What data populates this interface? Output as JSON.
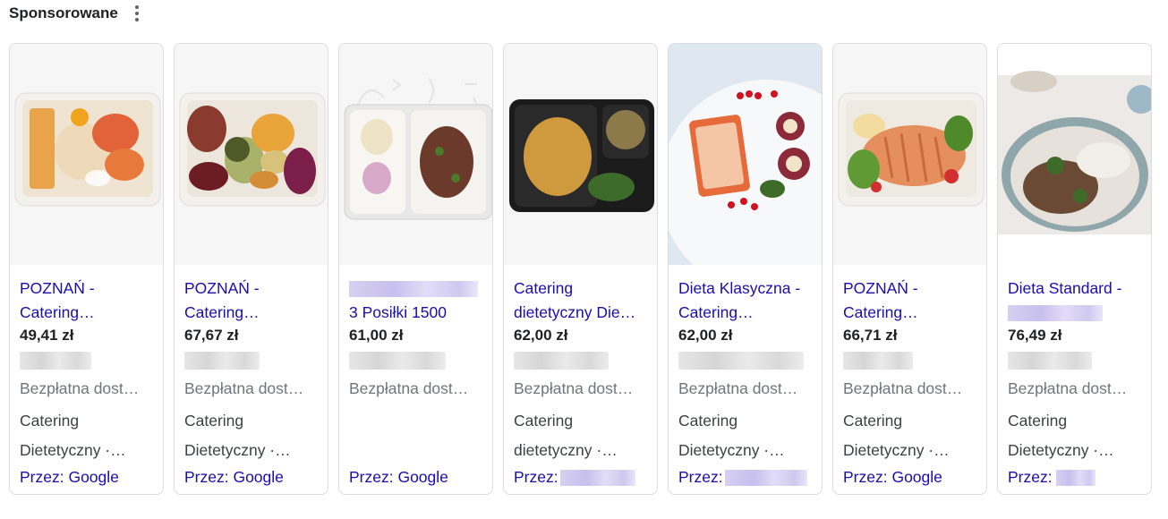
{
  "header": {
    "title": "Sponsorowane"
  },
  "colors": {
    "link": "#1a0dab",
    "muted": "#70757a",
    "border": "#dadce0"
  },
  "cards": [
    {
      "title_line1": "POZNAŃ -",
      "title_line2": "Catering…",
      "price": "49,41 zł",
      "shipping": "Bezpłatna dost…",
      "category_line1": "Catering",
      "category_line2": "Dietetyczny ·…",
      "via": "Przez: Google",
      "image": "meal-tray-salmon"
    },
    {
      "title_line1": "POZNAŃ -",
      "title_line2": "Catering…",
      "price": "67,67 zł",
      "shipping": "Bezpłatna dost…",
      "category_line1": "Catering",
      "category_line2": "Dietetyczny ·…",
      "via": "Przez: Google",
      "image": "meal-tray-buddha-bowl"
    },
    {
      "title_line1": "",
      "title_line2": "3 Posiłki 1500",
      "price": "61,00 zł",
      "shipping": "Bezpłatna dost…",
      "category_line1": "",
      "category_line2": "",
      "via": "Przez: Google",
      "image": "meal-tray-two-compartment"
    },
    {
      "title_line1": "Catering",
      "title_line2": "dietetyczny Die…",
      "price": "62,00 zł",
      "shipping": "Bezpłatna dost…",
      "category_line1": "Catering",
      "category_line2": "dietetyczny ·…",
      "via": "Przez:",
      "image": "meal-tray-black"
    },
    {
      "title_line1": "Dieta Klasyczna -",
      "title_line2": "Catering…",
      "price": "62,00 zł",
      "shipping": "Bezpłatna dost…",
      "category_line1": "Catering",
      "category_line2": "Dietetyczny ·…",
      "via": "Przez:",
      "image": "plated-dish-berries"
    },
    {
      "title_line1": "POZNAŃ -",
      "title_line2": "Catering…",
      "price": "66,71 zł",
      "shipping": "Bezpłatna dost…",
      "category_line1": "Catering",
      "category_line2": "Dietetyczny ·…",
      "via": "Przez: Google",
      "image": "meal-tray-chicken-salad"
    },
    {
      "title_line1": "Dieta Standard -",
      "title_line2": "",
      "price": "76,49 zł",
      "shipping": "Bezpłatna dost…",
      "category_line1": "Catering",
      "category_line2": "Dietetyczny ·…",
      "via": "Przez:",
      "image": "rice-bowl"
    }
  ]
}
